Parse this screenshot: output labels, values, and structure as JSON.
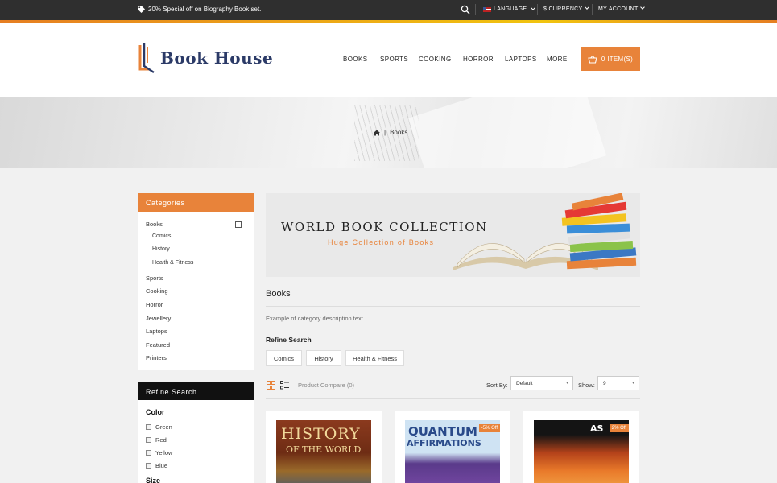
{
  "topbar": {
    "promo": "20% Special off on Biography Book set.",
    "language": "LANGUAGE",
    "currency": "$ CURRENCY",
    "account": "MY ACCOUNT"
  },
  "header": {
    "logo_text": "Book House",
    "nav": [
      "BOOKS",
      "SPORTS",
      "COOKING",
      "HORROR",
      "LAPTOPS",
      "MORE"
    ],
    "cart_label": "0 ITEM(S)"
  },
  "breadcrumb": {
    "current": "Books"
  },
  "sidebar": {
    "categories_title": "Categories",
    "categories": [
      {
        "label": "Books"
      },
      {
        "label": "Comics"
      },
      {
        "label": "History"
      },
      {
        "label": "Health & Fitness"
      },
      {
        "label": "Sports"
      },
      {
        "label": "Cooking"
      },
      {
        "label": "Horror"
      },
      {
        "label": "Jewellery"
      },
      {
        "label": "Laptops"
      },
      {
        "label": "Featured"
      },
      {
        "label": "Printers"
      }
    ],
    "refine_title": "Refine Search",
    "color_title": "Color",
    "colors": [
      "Green",
      "Red",
      "Yellow",
      "Blue"
    ],
    "size_title": "Size"
  },
  "banner": {
    "title": "WORLD BOOK COLLECTION",
    "subtitle": "Huge Collection of Books"
  },
  "main": {
    "title": "Books",
    "description": "Example of category description text",
    "refine_title": "Refine Search",
    "subcategories": [
      "Comics",
      "History",
      "Health & Fitness"
    ],
    "compare": "Product Compare (0)",
    "sort_label": "Sort By:",
    "sort_value": "Default",
    "show_label": "Show:",
    "show_value": "9"
  },
  "products": [
    {
      "cover_title": "HISTORY",
      "cover_sub": "OF THE WORLD",
      "badge": ""
    },
    {
      "cover_title": "QUANTUM",
      "cover_sub": "AFFIRMATIONS",
      "badge": "-5% Off"
    },
    {
      "cover_title": "AS",
      "cover_sub": "",
      "badge": "2% Off"
    }
  ],
  "colors": {
    "accent": "#e8833a",
    "dark": "#2f2f2f",
    "logo": "#2b3a67"
  }
}
